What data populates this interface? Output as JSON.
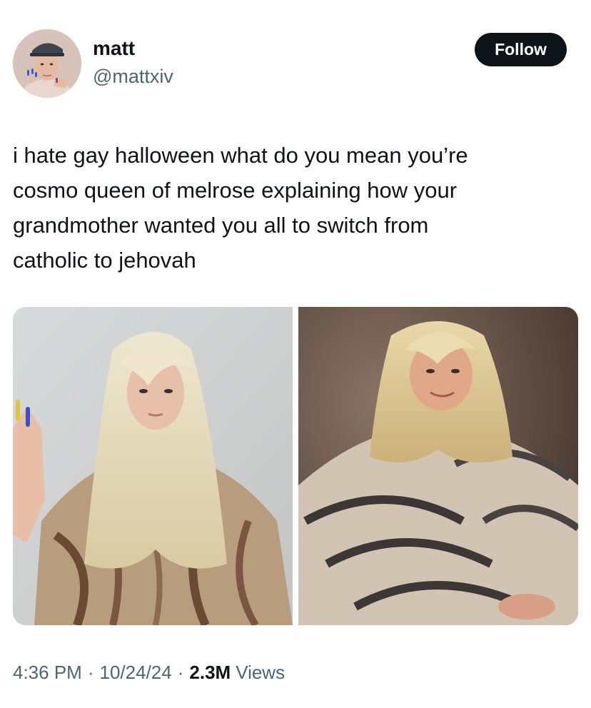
{
  "author": {
    "display_name": "matt",
    "handle": "@mattxiv"
  },
  "follow_button": {
    "label": "Follow"
  },
  "tweet": {
    "text": "i hate gay halloween what do you mean you’re\ncosmo queen of melrose explaining how your\ngrandmother wanted you all to switch from\ncatholic to jehovah"
  },
  "media": [
    {
      "description": "person-in-blonde-wig-and-fur-poncho"
    },
    {
      "description": "person-in-blonde-wig-and-fur-sweater"
    }
  ],
  "meta": {
    "time": "4:36 PM",
    "separator": "·",
    "date": "10/24/24",
    "views_count": "2.3M",
    "views_label": "Views"
  },
  "colors": {
    "text_primary": "#0f1419",
    "text_secondary": "#536471",
    "button_bg": "#0f1419",
    "button_text": "#ffffff"
  }
}
